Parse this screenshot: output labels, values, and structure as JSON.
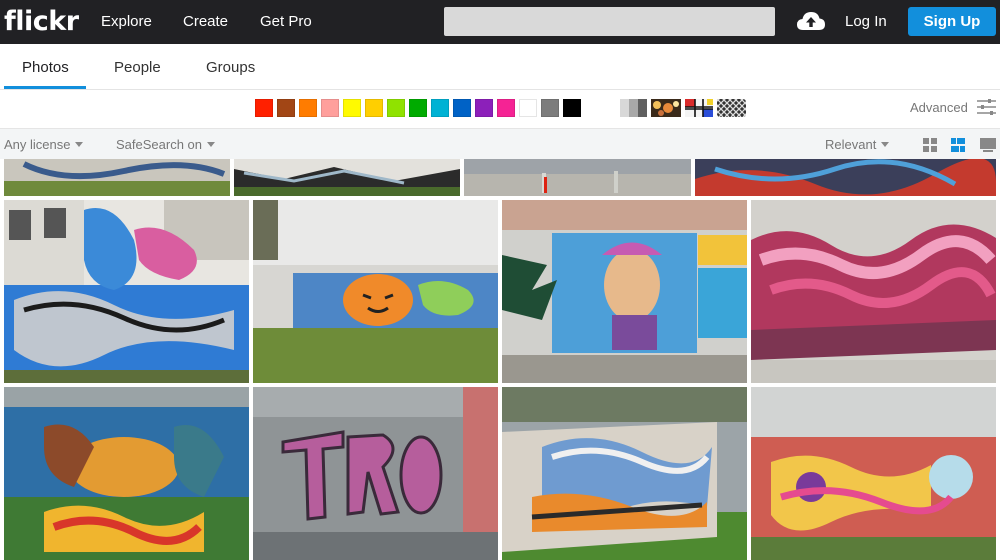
{
  "header": {
    "logo": "flickr",
    "nav": [
      "Explore",
      "Create",
      "Get Pro"
    ],
    "search_placeholder": "",
    "login_label": "Log In",
    "signup_label": "Sign Up"
  },
  "tabs": [
    {
      "label": "Photos",
      "active": true
    },
    {
      "label": "People",
      "active": false
    },
    {
      "label": "Groups",
      "active": false
    }
  ],
  "colors": [
    "#ff2000",
    "#a24615",
    "#ff7c00",
    "#ff9f9c",
    "#fffa00",
    "#ffcf00",
    "#90e200",
    "#00ab00",
    "#00b2d4",
    "#0062c6",
    "#8c20ba",
    "#f52394",
    "#ffffff",
    "#7c7c7c",
    "#000000"
  ],
  "advanced_label": "Advanced",
  "filters": {
    "license": "Any license",
    "safesearch": "SafeSearch on",
    "sort": "Relevant"
  },
  "accent_color": "#128fdc",
  "photos": [
    {
      "name": "graffiti-wall-top-1",
      "desc": "graffiti wall"
    },
    {
      "name": "graffiti-wall-top-2",
      "desc": "graffiti wall"
    },
    {
      "name": "graffiti-wall-top-3",
      "desc": "graffiti wall"
    },
    {
      "name": "graffiti-wall-top-4",
      "desc": "graffiti wall"
    },
    {
      "name": "graffiti-blue-building",
      "desc": "graffiti wall"
    },
    {
      "name": "graffiti-tiger",
      "desc": "graffiti wall"
    },
    {
      "name": "graffiti-character",
      "desc": "graffiti wall"
    },
    {
      "name": "graffiti-pink-letters",
      "desc": "graffiti wall"
    },
    {
      "name": "graffiti-mural-figures",
      "desc": "graffiti wall"
    },
    {
      "name": "graffiti-trons",
      "desc": "graffiti wall"
    },
    {
      "name": "graffiti-blue-orange",
      "desc": "graffiti wall"
    },
    {
      "name": "graffiti-pink-clouds",
      "desc": "graffiti wall"
    }
  ]
}
